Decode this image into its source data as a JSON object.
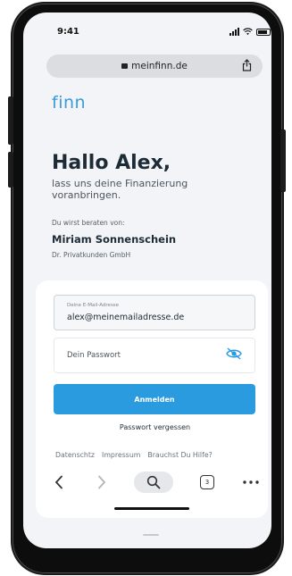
{
  "status_bar": {
    "time": "9:41"
  },
  "browser": {
    "url": "meinfinn.de",
    "tab_count": "3"
  },
  "page": {
    "brand": "finn",
    "greeting": "Hallo Alex,",
    "subtitle": "lass uns deine Finanzierung voranbringen.",
    "advisor_label": "Du wirst beraten von:",
    "advisor_name": "Miriam Sonnenschein",
    "advisor_company": "Dr. Privatkunden GmbH"
  },
  "login": {
    "email_label": "Deine E-Mail-Adresse",
    "email_value": "alex@meinemailadresse.de",
    "password_placeholder": "Dein Passwort",
    "login_button": "Anmelden",
    "forgot_password": "Passwort vergessen"
  },
  "footer_links": [
    "Datenschtz",
    "Impressum",
    "Brauchst Du Hilfe?"
  ],
  "icons": {
    "lock": "lock-icon",
    "share": "share-icon",
    "eye": "eye-icon",
    "back": "chevron-left-icon",
    "forward": "chevron-right-icon",
    "search": "search-icon",
    "tabs": "tabs-icon",
    "more": "more-icon"
  },
  "colors": {
    "brand": "#3a9bd9",
    "primary_button": "#2b9be0"
  }
}
